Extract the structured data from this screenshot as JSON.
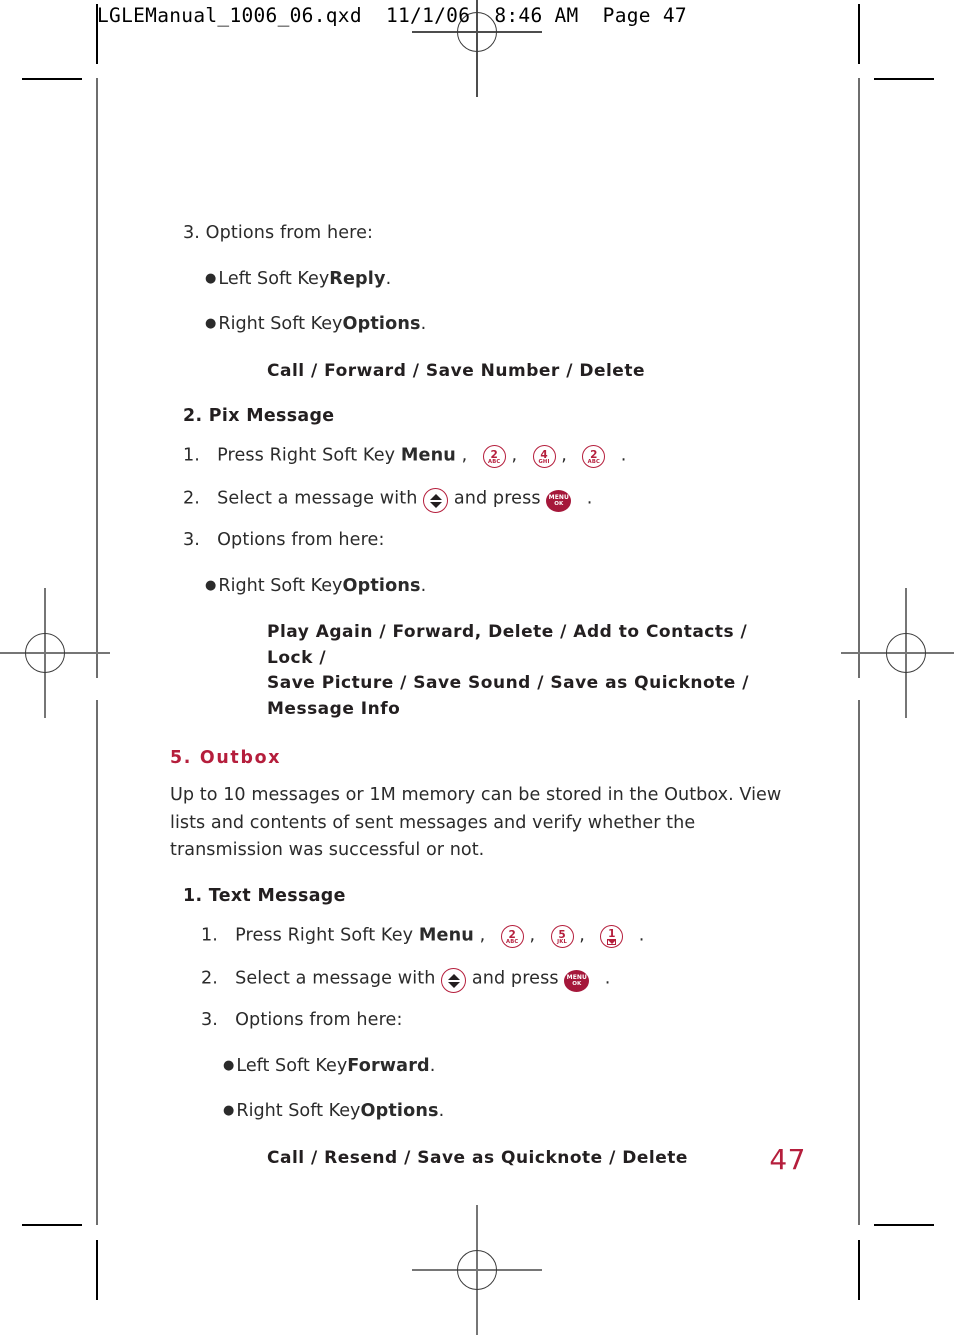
{
  "slug": "LGLEManual_1006_06.qxd  11/1/06  8:46 AM  Page 47",
  "folio": "47",
  "colors": {
    "accent_red": "#b51e3c",
    "menu_key_red": "#a5173a",
    "body_text": "#2b2b2b"
  },
  "sections": [
    {
      "id": "pix-options-intro",
      "step": "3. Options from here:",
      "bullets": [
        {
          "prefix": "Left Soft Key ",
          "bold": "Reply",
          "suffix": "."
        },
        {
          "prefix": "Right Soft Key ",
          "bold": "Options",
          "suffix": "."
        }
      ],
      "options": [
        "Call / Forward / Save Number / Delete"
      ]
    },
    {
      "id": "pix-message",
      "heading": "2. Pix Message",
      "heading_style": "bold-black",
      "steps": [
        {
          "number": "1.",
          "text_before": "Press Right Soft Key ",
          "bold": "Menu",
          "text_after": ",",
          "keys": [
            {
              "type": "keypad",
              "num": "2",
              "sub": "ABC"
            },
            {
              "type": "keypad",
              "num": "4",
              "sub": "GHI"
            },
            {
              "type": "keypad",
              "num": "2",
              "sub": "ABC"
            }
          ],
          "trailing": "."
        },
        {
          "number": "2.",
          "text_before": "Select a message with ",
          "nav_key": {
            "type": "nav-updown"
          },
          "text_mid": " and press ",
          "menu_key": {
            "type": "menu-ok",
            "line1": "MENU",
            "line2": "OK"
          },
          "trailing": "."
        },
        {
          "number": "3.",
          "text_before": "Options from here:"
        }
      ],
      "bullets": [
        {
          "prefix": "Right Soft Key ",
          "bold": "Options",
          "suffix": "."
        }
      ],
      "options": [
        "Play Again / Forward, Delete / Add to Contacts / Lock /",
        "Save Picture / Save Sound / Save as Quicknote /",
        "Message Info"
      ]
    },
    {
      "id": "outbox",
      "heading": "5. Outbox",
      "heading_style": "bold-red",
      "body": [
        "Up to 10 messages or 1M memory can be stored in the Outbox. View",
        "lists and contents of sent messages and verify whether the",
        "transmission was successful or not."
      ]
    },
    {
      "id": "text-message",
      "heading": "1. Text Message",
      "heading_style": "bold-black",
      "steps": [
        {
          "number": "1.",
          "text_before": "Press Right Soft Key ",
          "bold": "Menu",
          "text_after": ",",
          "keys": [
            {
              "type": "keypad",
              "num": "2",
              "sub": "ABC"
            },
            {
              "type": "keypad",
              "num": "5",
              "sub": "JKL"
            },
            {
              "type": "keypad",
              "num": "1",
              "sub": "envelope-icon"
            }
          ],
          "trailing": "."
        },
        {
          "number": "2.",
          "text_before": "Select a message with ",
          "nav_key": {
            "type": "nav-updown"
          },
          "text_mid": " and press ",
          "menu_key": {
            "type": "menu-ok",
            "line1": "MENU",
            "line2": "OK"
          },
          "trailing": "."
        },
        {
          "number": "3.",
          "text_before": "Options from here:"
        }
      ],
      "bullets": [
        {
          "prefix": "Left Soft Key ",
          "bold": "Forward",
          "suffix": "."
        },
        {
          "prefix": "Right Soft Key ",
          "bold": "Options",
          "suffix": "."
        }
      ],
      "options": [
        "Call / Resend / Save as Quicknote / Delete"
      ]
    }
  ]
}
